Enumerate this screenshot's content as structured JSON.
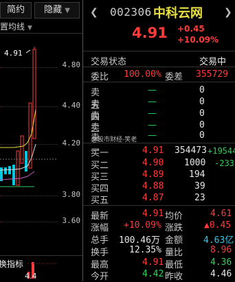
{
  "left_panel": {
    "tabs": [
      {
        "label": "简约"
      },
      {
        "label": "隐藏"
      }
    ],
    "avg_line_label": "设置均线",
    "price_tag": "4.91",
    "y_ticks": [
      "4.80",
      "4.40",
      "4.20",
      "3.80",
      "3.60"
    ],
    "indicator_label": "换指标",
    "bottom_value": "4.4"
  },
  "header": {
    "code": "002306",
    "name": "中科云网",
    "price": "4.91",
    "change": "+0.45",
    "change_pct": "+10.09%"
  },
  "status": {
    "label": "交易状态",
    "value": "交易中"
  },
  "ratio": {
    "weibi_label": "委比",
    "weibi_value": "100.00%",
    "weicha_label": "委差",
    "weicha_value": "355729"
  },
  "asks": [
    {
      "label": "卖五",
      "price": "—",
      "vol": "0"
    },
    {
      "label": "卖四",
      "price": "—",
      "vol": "0"
    },
    {
      "label": "卖三",
      "price": "—",
      "vol": "0"
    },
    {
      "label": "卖二",
      "price": "—",
      "vol": "0"
    },
    {
      "label": "卖一",
      "price": "—",
      "vol": "0"
    }
  ],
  "watermark": "@股市财经-笑老",
  "bids": [
    {
      "label": "买一",
      "price": "4.91",
      "vol": "354473",
      "delta": "+19544"
    },
    {
      "label": "买二",
      "price": "4.90",
      "vol": "1000",
      "delta": "-233"
    },
    {
      "label": "买三",
      "price": "4.89",
      "vol": "194",
      "delta": ""
    },
    {
      "label": "买四",
      "price": "4.88",
      "vol": "39",
      "delta": ""
    },
    {
      "label": "买五",
      "price": "4.87",
      "vol": "23",
      "delta": ""
    }
  ],
  "stats": [
    {
      "l1": "最新",
      "v1": "4.91",
      "l2": "均价",
      "v2": "4.61"
    },
    {
      "l1": "涨幅",
      "v1": "+10.09%",
      "l2": "涨跌",
      "v2": "▲0.45"
    },
    {
      "l1": "总手",
      "v1": "100.46万",
      "l2": "金额",
      "v2": "4.63亿"
    },
    {
      "l1": "换手",
      "v1": "12.35%",
      "l2": "量比",
      "v2": "8.96"
    },
    {
      "l1": "最高",
      "v1": "4.91",
      "l2": "最低",
      "v2": "4.36"
    },
    {
      "l1": "今开",
      "v1": "4.42",
      "l2": "昨收",
      "v2": "4.46"
    }
  ],
  "colors": {
    "up": "#ff3b3b",
    "down": "#2ed158",
    "name": "#e8e040",
    "cyan": "#33c8e8"
  }
}
